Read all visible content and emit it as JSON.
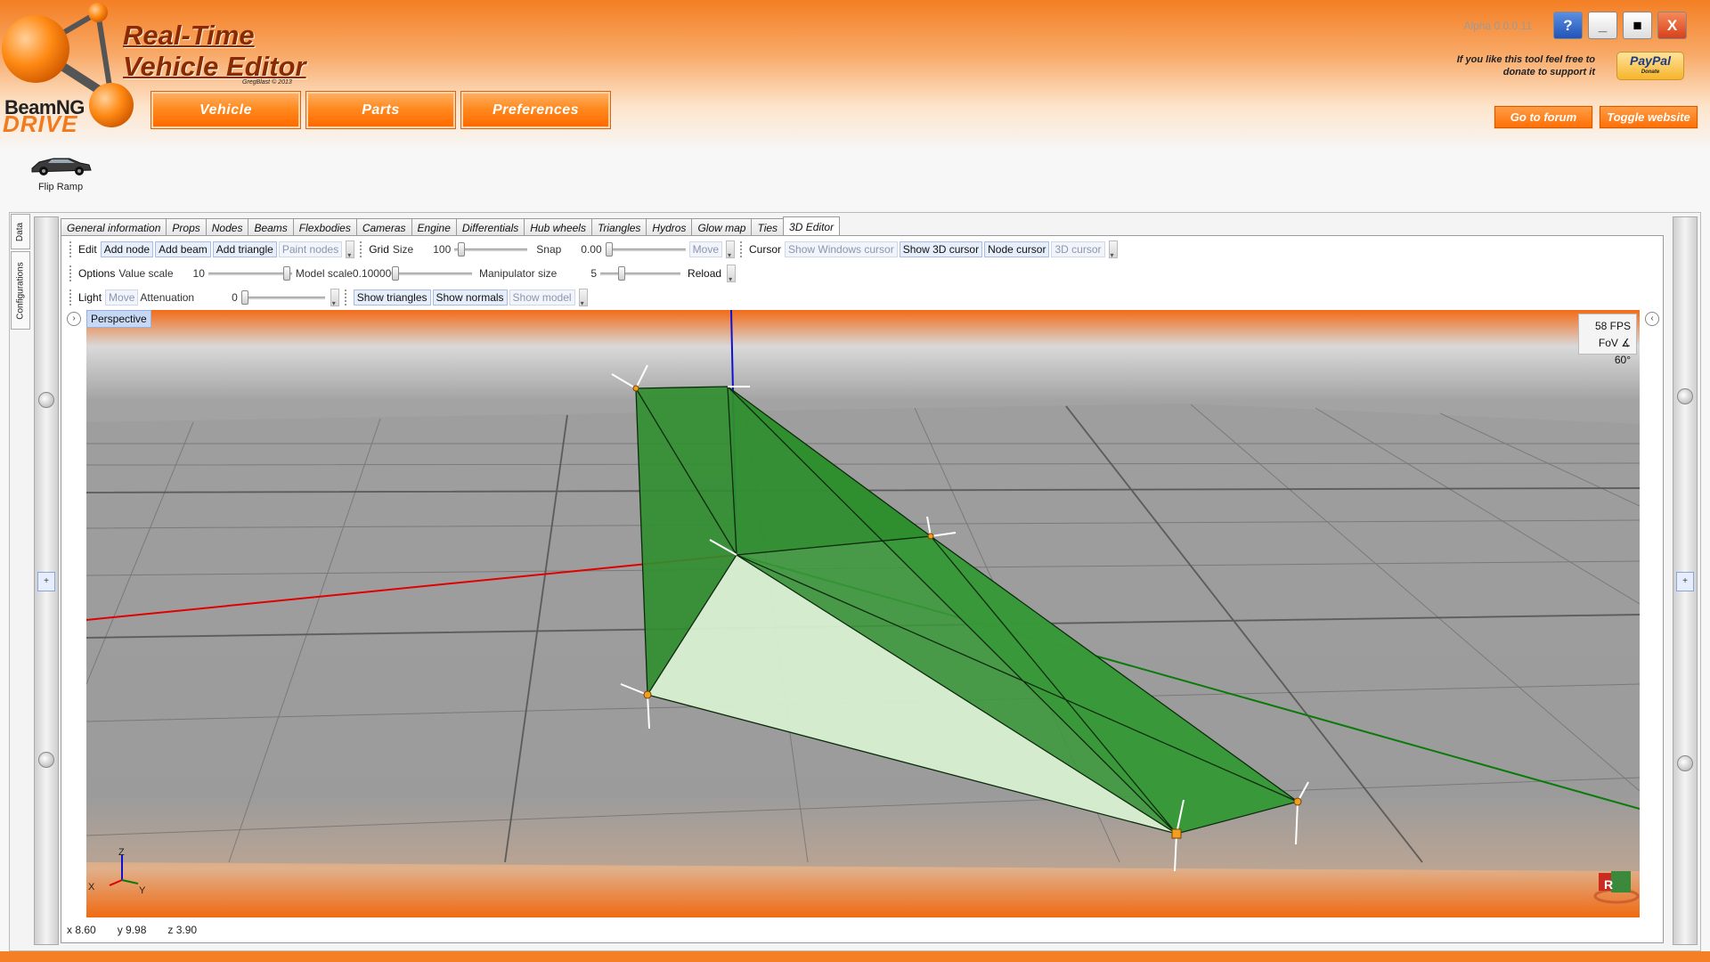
{
  "app": {
    "title_line1": "Real-Time",
    "title_line2": "Vehicle Editor",
    "credit": "GregBlast © 2013",
    "brand_line1": "BeamNG",
    "brand_line2": "DRIVE",
    "version": "Alpha 0.0.0.11"
  },
  "nav": {
    "vehicle": "Vehicle",
    "parts": "Parts",
    "preferences": "Preferences"
  },
  "window": {
    "help": "?",
    "minimize": "_",
    "maximize": "■",
    "close": "X"
  },
  "donate": {
    "text_line1": "If you like this tool feel free to",
    "text_line2": "donate to support it",
    "paypal": "PayPal",
    "paypal_sub": "Donate"
  },
  "links": {
    "forum": "Go to forum",
    "website": "Toggle website"
  },
  "vehicle": {
    "name": "Flip Ramp"
  },
  "side_tabs": {
    "data": "Data",
    "configurations": "Configurations"
  },
  "tabs": [
    "General information",
    "Props",
    "Nodes",
    "Beams",
    "Flexbodies",
    "Cameras",
    "Engine",
    "Differentials",
    "Hub wheels",
    "Triangles",
    "Hydros",
    "Glow map",
    "Ties",
    "3D Editor"
  ],
  "toolbar_edit": {
    "label": "Edit",
    "add_node": "Add node",
    "add_beam": "Add beam",
    "add_triangle": "Add triangle",
    "paint_nodes": "Paint nodes",
    "grid_label": "Grid",
    "size_label": "Size",
    "size_value": "100",
    "snap_label": "Snap",
    "snap_value": "0.00",
    "move": "Move",
    "cursor_label": "Cursor",
    "show_windows_cursor": "Show Windows cursor",
    "show_3d_cursor": "Show 3D cursor",
    "node_cursor": "Node cursor",
    "cursor_3d": "3D cursor"
  },
  "toolbar_options": {
    "label": "Options",
    "value_scale_label": "Value scale",
    "value_scale": "10",
    "model_scale_label": "Model scale",
    "model_scale": "0.100000",
    "manipulator_label": "Manipulator size",
    "manipulator_size": "5",
    "reload": "Reload"
  },
  "toolbar_light": {
    "label": "Light",
    "move": "Move",
    "attenuation_label": "Attenuation",
    "attenuation": "0",
    "show_triangles": "Show triangles",
    "show_normals": "Show normals",
    "show_model": "Show model"
  },
  "viewport": {
    "mode": "Perspective",
    "fps": "58 FPS",
    "fov": "FoV ∡ 60°",
    "axis_z": "Z",
    "axis_x": "X",
    "axis_y": "Y",
    "gizmo_r": "R",
    "colors": {
      "x_axis": "#e00000",
      "y_axis": "#0a7a0a",
      "z_axis": "#1010d0",
      "mesh": "#2f8f2f"
    }
  },
  "status": {
    "x": "x 8.60",
    "y": "y 9.98",
    "z": "z 3.90"
  }
}
